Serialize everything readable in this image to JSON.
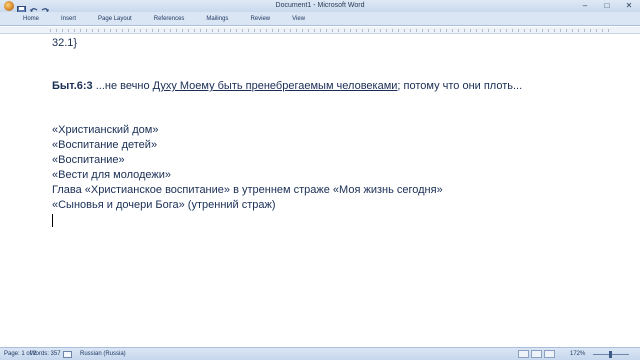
{
  "window": {
    "title": "Document1 - Microsoft Word",
    "controls": {
      "minimize": "–",
      "maximize": "□",
      "close": "✕"
    }
  },
  "quick_access": [
    "office-logo",
    "save-icon",
    "undo-icon",
    "redo-icon"
  ],
  "ribbon": {
    "tabs": [
      "Home",
      "Insert",
      "Page Layout",
      "References",
      "Mailings",
      "Review",
      "View"
    ]
  },
  "document": {
    "lines": {
      "l1": "32.1}",
      "l2_ref": "Быт.6:3",
      "l2_a": " ...не вечно ",
      "l2_u": "Духу Моему быть пренебрегаемым человеками",
      "l2_b": "; потому что они плоть...",
      "l3": "«Христианский дом»",
      "l4": "«Воспитание детей»",
      "l5": "«Воспитание»",
      "l6": "«Вести для молодежи»",
      "l7": "Глава «Христианское воспитание» в утреннем страже  «Моя жизнь сегодня»",
      "l8": " «Сыновья и дочери Бога» (утренний страж)"
    }
  },
  "status": {
    "page": "Page: 1 of 2",
    "words": "Words: 357",
    "language": "Russian (Russia)",
    "zoom": "172%"
  },
  "colors": {
    "text": "#1a2e55",
    "ribbon": "#dbe6f4"
  }
}
